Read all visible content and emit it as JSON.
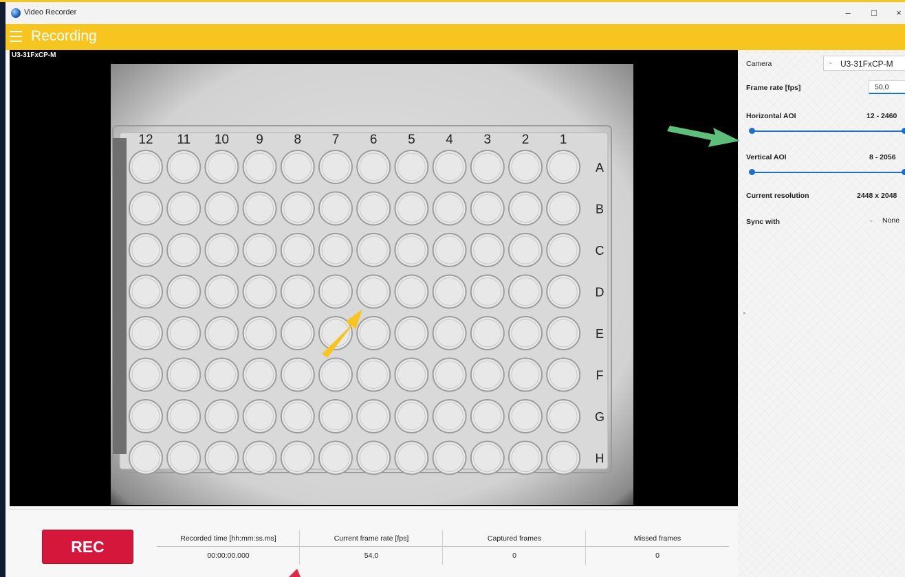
{
  "window": {
    "title": "Video Recorder",
    "minimize": "–",
    "maximize": "□",
    "close": "×"
  },
  "appbar": {
    "title": "Recording"
  },
  "video": {
    "camera_label": "U3-31FxCP-M"
  },
  "plate": {
    "columns": [
      "12",
      "11",
      "10",
      "9",
      "8",
      "7",
      "6",
      "5",
      "4",
      "3",
      "2",
      "1"
    ],
    "rows": [
      "A",
      "B",
      "C",
      "D",
      "E",
      "F",
      "G",
      "H"
    ]
  },
  "panel": {
    "camera": {
      "label": "Camera",
      "value": "U3-31FxCP-M"
    },
    "frame_rate": {
      "label": "Frame rate [fps]",
      "value": "50,0"
    },
    "horizontal_aoi": {
      "label": "Horizontal AOI",
      "value": "12 - 2460"
    },
    "vertical_aoi": {
      "label": "Vertical AOI",
      "value": "8 - 2056"
    },
    "resolution": {
      "label": "Current resolution",
      "value": "2448 x 2048"
    },
    "sync": {
      "label": "Sync with",
      "value": "None"
    }
  },
  "controls": {
    "rec_label": "REC"
  },
  "stats": {
    "recorded_time": {
      "header": "Recorded time [hh:mm:ss.ms]",
      "value": "00:00:00.000"
    },
    "frame_rate": {
      "header": "Current frame rate [fps]",
      "value": "54,0"
    },
    "captured": {
      "header": "Captured frames",
      "value": "0"
    },
    "missed": {
      "header": "Missed frames",
      "value": "0"
    }
  },
  "annotation_colors": {
    "green_arrow": "#5dbf7a",
    "yellow_arrow": "#f6c520",
    "red_arrow": "#e0294a"
  }
}
